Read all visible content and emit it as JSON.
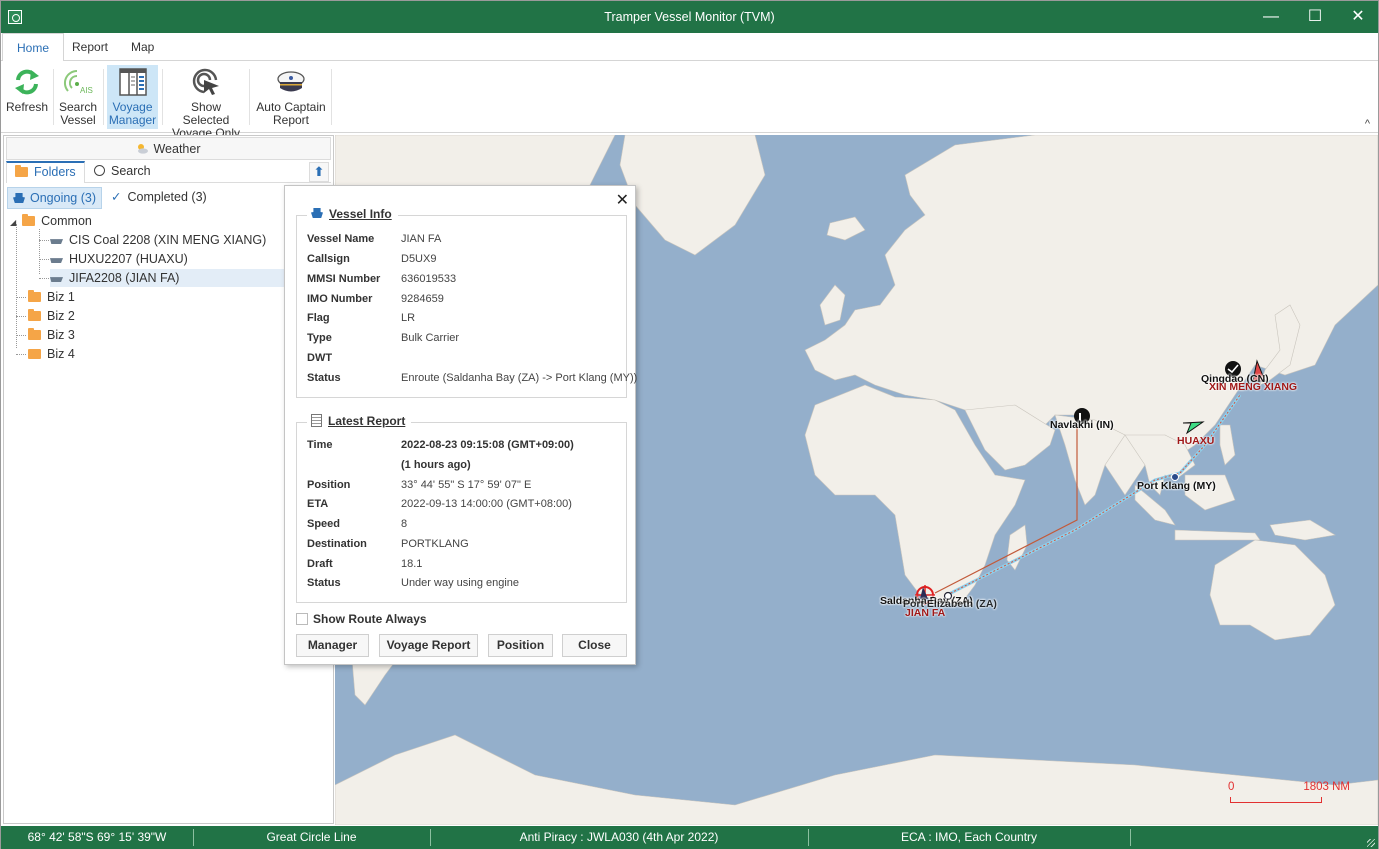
{
  "window": {
    "title": "Tramper Vessel Monitor (TVM)",
    "controls": {
      "minimize": "—",
      "maximize": "☐",
      "close": "✕"
    }
  },
  "ribbon": {
    "tabs": [
      {
        "label": "Home",
        "active": true
      },
      {
        "label": "Report",
        "active": false
      },
      {
        "label": "Map",
        "active": false
      }
    ],
    "buttons": [
      {
        "label_1": "Refresh",
        "label_2": "",
        "icon": "refresh-icon"
      },
      {
        "label_1": "Search",
        "label_2": "Vessel",
        "icon": "ais-signal-icon"
      },
      {
        "label_1": "Voyage",
        "label_2": "Manager",
        "icon": "voyage-manager-icon",
        "selected": true
      },
      {
        "label_1": "Show Selected",
        "label_2": "Voyage Only",
        "icon": "target-cursor-icon"
      },
      {
        "label_1": "Auto Captain",
        "label_2": "Report",
        "icon": "captain-hat-icon"
      }
    ],
    "collapse_glyph": "^"
  },
  "left_panel": {
    "weather_label": "Weather",
    "tabs": [
      {
        "label": "Folders",
        "active": true
      },
      {
        "label": "Search",
        "active": false
      }
    ],
    "up_glyph": "⬆",
    "filters": [
      {
        "label": "Ongoing (3)",
        "active": true
      },
      {
        "label": "Completed (3)",
        "active": false
      }
    ],
    "tree": {
      "root": {
        "label": "Common",
        "expander": "◢"
      },
      "voyages": [
        {
          "label": "CIS Coal 2208 (XIN MENG XIANG)",
          "selected": false
        },
        {
          "label": "HUXU2207 (HUAXU)",
          "selected": false
        },
        {
          "label": "JIFA2208 (JIAN FA)",
          "selected": true
        }
      ],
      "folders": [
        "Biz 1",
        "Biz 2",
        "Biz 3",
        "Biz 4"
      ]
    }
  },
  "popup": {
    "close_glyph": "✕",
    "vessel_info": {
      "title": "Vessel Info",
      "rows": [
        {
          "key": "Vessel Name",
          "value": "JIAN FA"
        },
        {
          "key": "Callsign",
          "value": "D5UX9"
        },
        {
          "key": "MMSI Number",
          "value": "636019533"
        },
        {
          "key": "IMO Number",
          "value": "9284659"
        },
        {
          "key": "Flag",
          "value": "LR"
        },
        {
          "key": "Type",
          "value": "Bulk Carrier"
        },
        {
          "key": "DWT",
          "value": ""
        },
        {
          "key": "Status",
          "value": "Enroute (Saldanha Bay (ZA) -> Port Klang (MY))"
        }
      ]
    },
    "latest_report": {
      "title": "Latest Report",
      "time": "2022-08-23 09:15:08 (GMT+09:00)",
      "time_ago": "(1 hours ago)",
      "rows": [
        {
          "key": "Time",
          "value": ""
        },
        {
          "key": "Position",
          "value": "33° 44' 55\" S 17° 59' 07\" E"
        },
        {
          "key": "ETA",
          "value": "2022-09-13 14:00:00 (GMT+08:00)"
        },
        {
          "key": "Speed",
          "value": "8"
        },
        {
          "key": "Destination",
          "value": "PORTKLANG"
        },
        {
          "key": "Draft",
          "value": "18.1"
        },
        {
          "key": "Status",
          "value": "Under way using engine"
        }
      ]
    },
    "show_route_always": {
      "label": "Show Route Always",
      "checked": false
    },
    "buttons": [
      "Manager",
      "Voyage Report",
      "Position",
      "Close"
    ]
  },
  "map": {
    "ports": [
      {
        "label": "Qingdao (CN)"
      },
      {
        "label": "Navlakhi (IN)"
      },
      {
        "label": "Port Klang (MY)"
      },
      {
        "label": "Saldanha Bay (ZA)"
      },
      {
        "label": "Port Elizabeth (ZA)"
      }
    ],
    "vessels": [
      {
        "label": "XIN MENG XIANG",
        "color": "#e04848"
      },
      {
        "label": "HUAXU",
        "color": "#3ddc84"
      },
      {
        "label": "JIAN FA",
        "color": "#e02020"
      }
    ],
    "scale": {
      "start": "0",
      "end": "1803 NM"
    },
    "colors": {
      "water": "#94afcb",
      "land": "#f2efe9"
    }
  },
  "statusbar": {
    "coordinates": "68° 42' 58\"S 69° 15' 39\"W",
    "line_mode": "Great Circle Line",
    "anti_piracy": "Anti Piracy : JWLA030 (4th Apr 2022)",
    "eca": "ECA : IMO, Each Country"
  }
}
